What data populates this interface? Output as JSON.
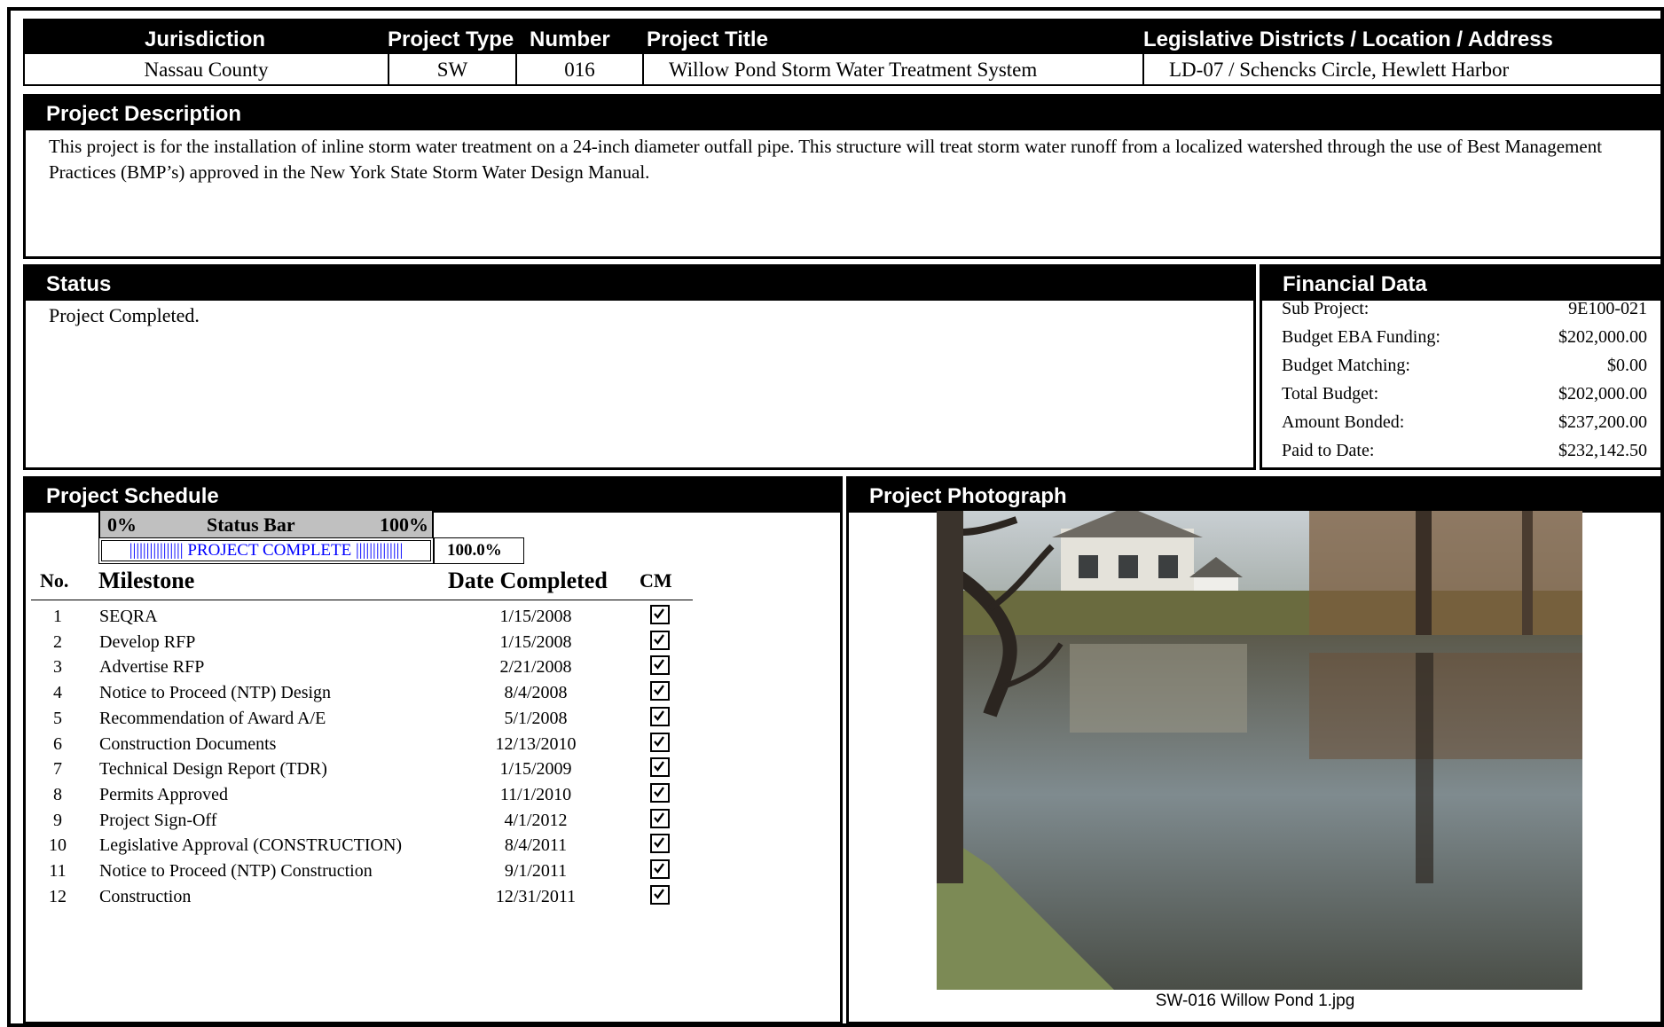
{
  "header": {
    "jurisdiction_label": "Jurisdiction",
    "project_type_label": "Project Type",
    "number_label": "Number",
    "project_title_label": "Project Title",
    "location_label": "Legislative Districts / Location / Address",
    "jurisdiction": "Nassau County",
    "project_type": "SW",
    "number": "016",
    "project_title": "Willow Pond Storm Water Treatment System",
    "location": "LD-07 / Schencks Circle, Hewlett Harbor"
  },
  "description": {
    "title": "Project Description",
    "text": "This project is for the installation of inline storm water treatment on a 24-inch diameter outfall pipe.  This structure will treat storm water runoff from a localized watershed through the use of Best Management Practices (BMP’s) approved in the New York State Storm Water Design Manual."
  },
  "status": {
    "title": "Status",
    "text": "Project Completed."
  },
  "financial": {
    "title": "Financial Data",
    "rows": [
      {
        "label": "Sub Project:",
        "value": "9E100-021"
      },
      {
        "label": "Budget EBA Funding:",
        "value": "$202,000.00"
      },
      {
        "label": "Budget Matching:",
        "value": "$0.00"
      },
      {
        "label": "Total Budget:",
        "value": "$202,000.00"
      },
      {
        "label": "Amount Bonded:",
        "value": "$237,200.00"
      },
      {
        "label": "Paid to Date:",
        "value": "$232,142.50"
      }
    ]
  },
  "schedule": {
    "title": "Project Schedule",
    "status_bar": {
      "min_label": "0%",
      "title": "Status Bar",
      "max_label": "100%",
      "bar_text": "|||||||||||||||| PROJECT COMPLETE ||||||||||||||",
      "percent": "100.0%",
      "progress": 1.0
    },
    "columns": {
      "no": "No.",
      "milestone": "Milestone",
      "date": "Date Completed",
      "cm": "CM"
    },
    "milestones": [
      {
        "no": "1",
        "name": "SEQRA",
        "date": "1/15/2008",
        "cm": true
      },
      {
        "no": "2",
        "name": "Develop RFP",
        "date": "1/15/2008",
        "cm": true
      },
      {
        "no": "3",
        "name": "Advertise RFP",
        "date": "2/21/2008",
        "cm": true
      },
      {
        "no": "4",
        "name": "Notice to Proceed (NTP) Design",
        "date": "8/4/2008",
        "cm": true
      },
      {
        "no": "5",
        "name": "Recommendation of Award A/E",
        "date": "5/1/2008",
        "cm": true
      },
      {
        "no": "6",
        "name": "Construction Documents",
        "date": "12/13/2010",
        "cm": true
      },
      {
        "no": "7",
        "name": "Technical Design Report (TDR)",
        "date": "1/15/2009",
        "cm": true
      },
      {
        "no": "8",
        "name": "Permits Approved",
        "date": "11/1/2010",
        "cm": true
      },
      {
        "no": "9",
        "name": "Project Sign-Off",
        "date": "4/1/2012",
        "cm": true
      },
      {
        "no": "10",
        "name": "Legislative Approval (CONSTRUCTION)",
        "date": "8/4/2011",
        "cm": true
      },
      {
        "no": "11",
        "name": "Notice to Proceed (NTP) Construction",
        "date": "9/1/2011",
        "cm": true
      },
      {
        "no": "12",
        "name": "Construction",
        "date": "12/31/2011",
        "cm": true
      }
    ]
  },
  "photograph": {
    "title": "Project Photograph",
    "caption": "SW-016 Willow Pond 1.jpg"
  },
  "colors": {
    "header_bg": "#000000",
    "status_bar_gray": "#c0c0c0",
    "status_bar_text": "#0000ff"
  }
}
